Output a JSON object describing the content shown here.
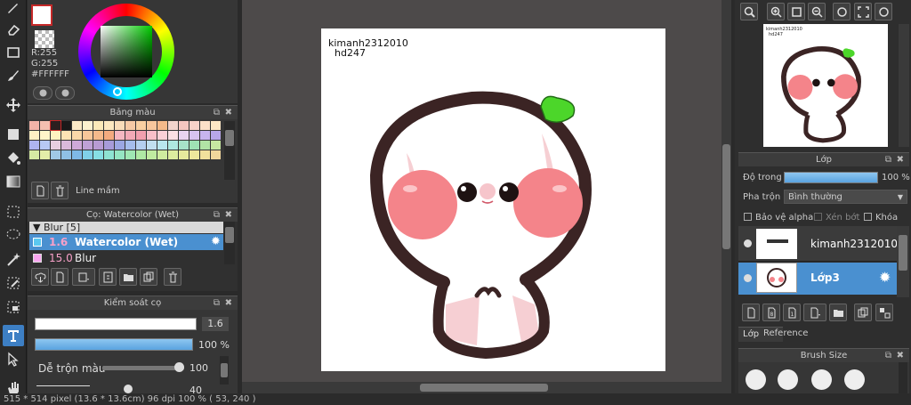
{
  "color": {
    "r_label": "R:255",
    "g_label": "G:255",
    "hex_label": "#FFFFFF",
    "foreground": "#ffffff",
    "accent": "#c62828"
  },
  "palette": {
    "title": "Bảng màu",
    "tool_label": "Line mầm",
    "colors": [
      "#f2b3a8",
      "#f4bfb0",
      "#2b1f1f",
      "#1a1a1a",
      "#fbe9c6",
      "#fdf1cf",
      "#fce9b9",
      "#fde8c0",
      "#f9dcb9",
      "#f6c9a5",
      "#f9cfa2",
      "#f7c69d",
      "#f5b98a",
      "#f2d3cc",
      "#f5c6c0",
      "#f8d2c9",
      "#fbe0c8",
      "#fde7c5",
      "#fff1c4",
      "#fff5c9",
      "#fef3c0",
      "#fde4b4",
      "#fbd8a8",
      "#f8c79a",
      "#f5b98b",
      "#f3aa7f",
      "#f5b7c1",
      "#f3a9b6",
      "#f29fae",
      "#f8bfc9",
      "#fbd0d7",
      "#fde0e4",
      "#e8d3f0",
      "#d7c3ef",
      "#c7b4ee",
      "#b8a7ea",
      "#aeb4f0",
      "#b7c8f4",
      "#e8cfe0",
      "#d9b9db",
      "#cfa9d9",
      "#bfa1d6",
      "#b79bd3",
      "#a79bd9",
      "#9ba7e3",
      "#a5bdec",
      "#b5cfef",
      "#c1dff0",
      "#b9e6ee",
      "#aee8e0",
      "#a7e2c9",
      "#9fe1b4",
      "#b1e3a5",
      "#c6e7a1",
      "#d5eaa3",
      "#e3eda9",
      "#a0c8e6",
      "#8fc0e5",
      "#7fb9e6",
      "#80d0e8",
      "#87dfe4",
      "#8ee3d2",
      "#95e5c2",
      "#9fe7b3",
      "#afe9a4",
      "#c0eba0",
      "#cfec9f",
      "#ddec9e",
      "#e7ea9c",
      "#eee79c",
      "#f1e09c",
      "#f1d79c"
    ]
  },
  "brush_panel": {
    "title": "Cọ: Watercolor (Wet)",
    "group_label": "Blur [5]",
    "items": [
      {
        "size": "1.6",
        "name": "Watercolor (Wet)",
        "swatch": "#5bc8f0"
      },
      {
        "size": "15.0",
        "name": "Blur",
        "swatch": "#f9a6f0"
      }
    ]
  },
  "brush_control": {
    "title": "Kiểm soát cọ",
    "size_value": "1.6",
    "opacity_value": "100 %",
    "opacity_fraction": 1.0,
    "mix_label": "Dễ trộn màu",
    "mix_value": "100",
    "next_value": "40"
  },
  "canvas": {
    "watermark_line1": "kimanh2312010",
    "watermark_line2": "hd247"
  },
  "navigator": {
    "thumb_text_line1": "kimanh2312010",
    "thumb_text_line2": "hd247"
  },
  "layers": {
    "title": "Lớp",
    "opacity_label": "Độ trong",
    "opacity_value": "100 %",
    "opacity_fraction": 1.0,
    "blend_label": "Pha trộn",
    "blend_value": "Bình thường",
    "protect_alpha": "Bảo vệ alpha",
    "clip_label": "Xén bớt",
    "lock_label": "Khóa",
    "rows": [
      {
        "name": "kimanh2312010"
      },
      {
        "name": "Lớp3"
      }
    ],
    "tab_layers": "Lớp",
    "tab_reference": "Reference"
  },
  "brush_size": {
    "title": "Brush Size"
  },
  "status_bar": {
    "text": "515 * 514 pixel   (13.6 * 13.6cm)   96 dpi   100 %   ( 53, 240 )"
  }
}
